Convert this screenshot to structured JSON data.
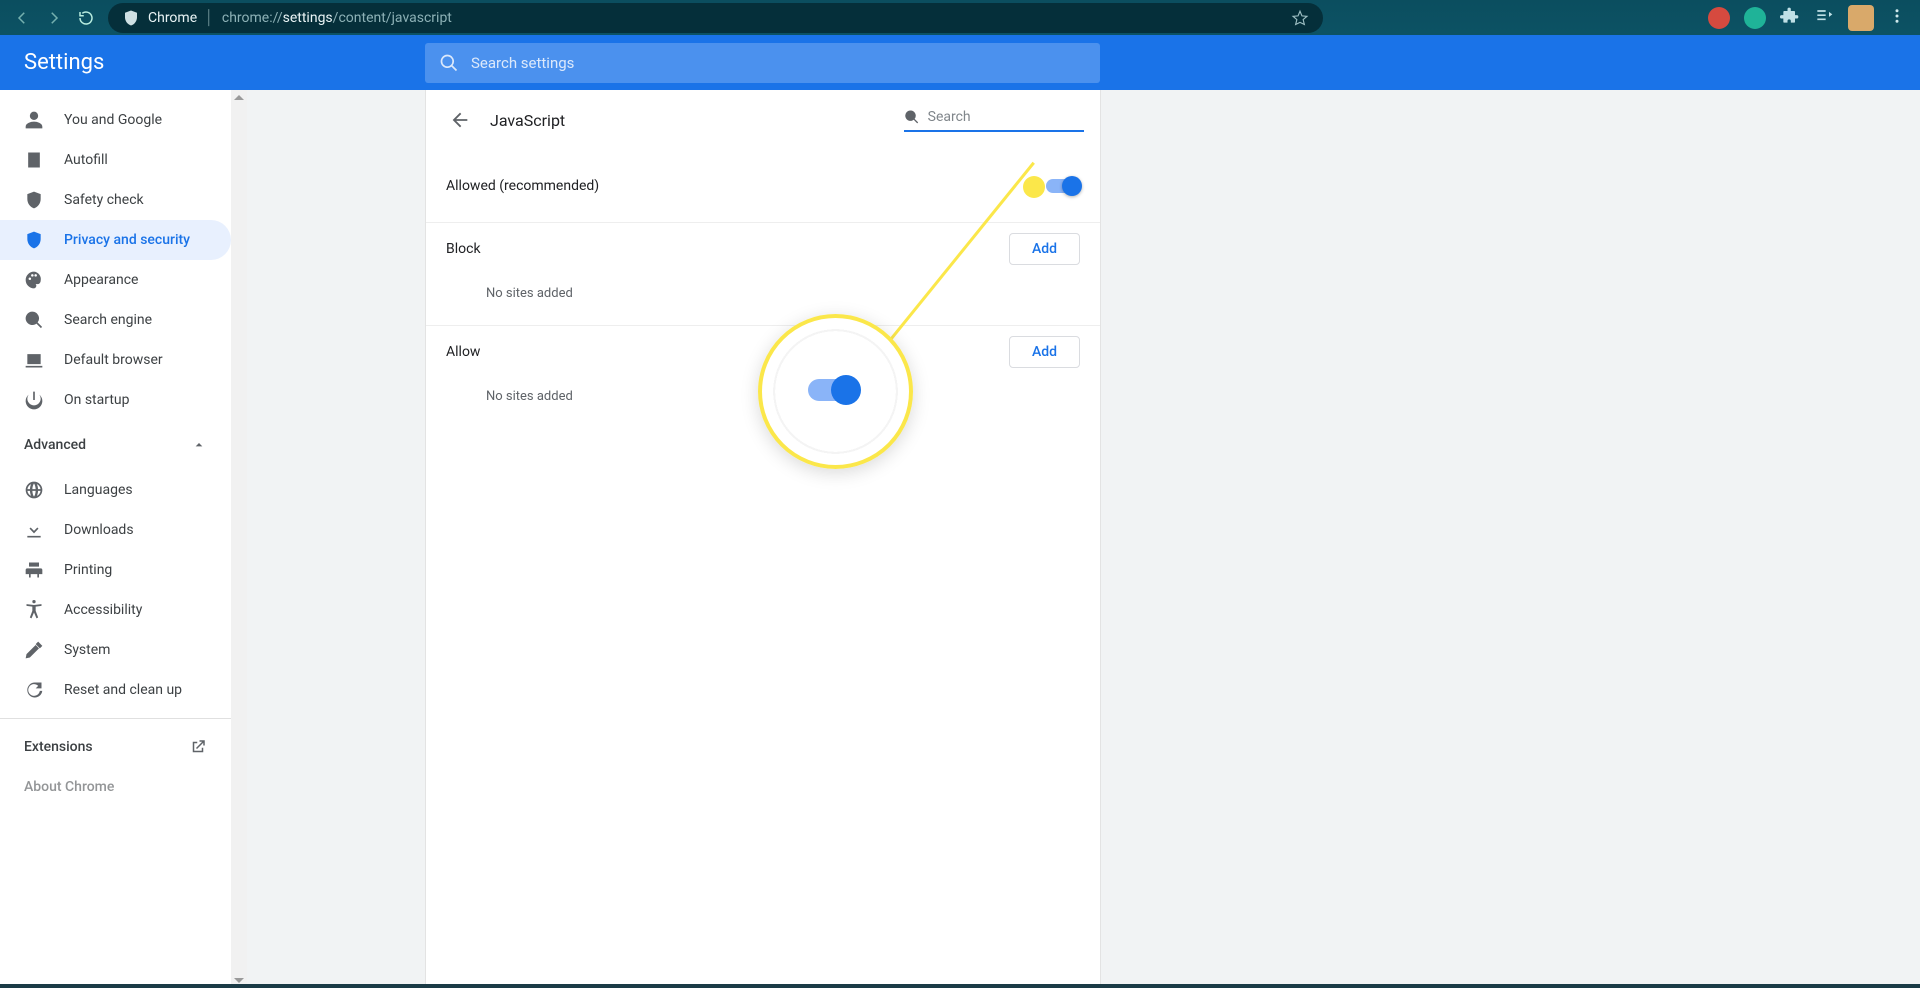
{
  "browser": {
    "scheme_app": "Chrome",
    "url_prefix": "chrome://",
    "url_bold": "settings",
    "url_suffix": "/content/javascript"
  },
  "header": {
    "title": "Settings",
    "search_placeholder": "Search settings"
  },
  "sidebar": {
    "items": [
      {
        "id": "you",
        "label": "You and Google"
      },
      {
        "id": "autofill",
        "label": "Autofill"
      },
      {
        "id": "safety",
        "label": "Safety check"
      },
      {
        "id": "privacy",
        "label": "Privacy and security",
        "active": true
      },
      {
        "id": "appearance",
        "label": "Appearance"
      },
      {
        "id": "search",
        "label": "Search engine"
      },
      {
        "id": "default",
        "label": "Default browser"
      },
      {
        "id": "startup",
        "label": "On startup"
      }
    ],
    "advanced_label": "Advanced",
    "advanced_items": [
      {
        "id": "languages",
        "label": "Languages"
      },
      {
        "id": "downloads",
        "label": "Downloads"
      },
      {
        "id": "printing",
        "label": "Printing"
      },
      {
        "id": "accessibility",
        "label": "Accessibility"
      },
      {
        "id": "system",
        "label": "System"
      },
      {
        "id": "reset",
        "label": "Reset and clean up"
      }
    ],
    "extensions_label": "Extensions",
    "about_label": "About Chrome"
  },
  "content": {
    "back_title": "JavaScript",
    "search_placeholder": "Search",
    "allowed_label": "Allowed (recommended)",
    "allowed_on": true,
    "sections": [
      {
        "title": "Block",
        "add_label": "Add",
        "empty_text": "No sites added"
      },
      {
        "title": "Allow",
        "add_label": "Add",
        "empty_text": "No sites added"
      }
    ]
  }
}
